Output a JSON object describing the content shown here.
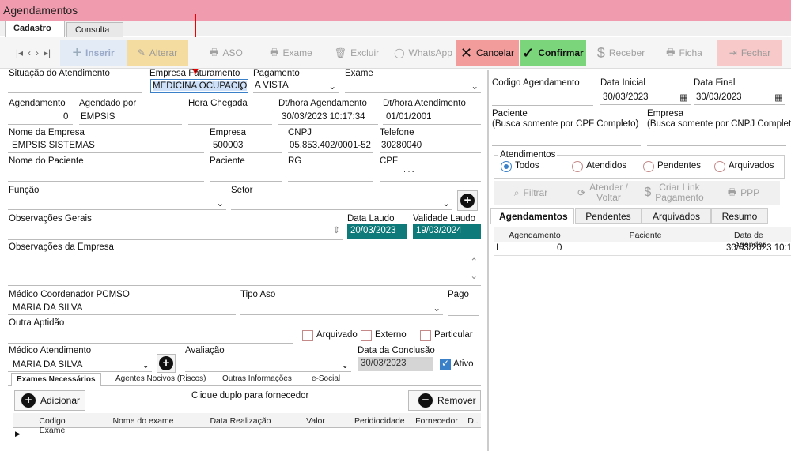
{
  "window": {
    "title": "Agendamentos"
  },
  "tabs": [
    {
      "label": "Cadastro"
    },
    {
      "label": "Consulta"
    }
  ],
  "toolbar": {
    "inserir": "Inserir",
    "alterar": "Alterar",
    "aso": "ASO",
    "exame": "Exame",
    "excluir": "Excluir",
    "whatsapp": "WhatsApp",
    "cancelar": "Cancelar",
    "confirmar": "Confirmar",
    "receber": "Receber",
    "ficha": "Ficha",
    "fechar": "Fechar"
  },
  "form": {
    "situacao_label": "Situação do Atendimento",
    "empresa_fat_label": "Empresa Faturamento",
    "empresa_fat_value": "MEDICINA OCUPACIO",
    "pagamento_label": "Pagamento",
    "pagamento_value": "A VISTA",
    "exame_label": "Exame",
    "agendamento_label": "Agendamento",
    "agendamento_value": "0",
    "agendado_por_label": "Agendado por",
    "agendado_por_value": "EMPSIS",
    "hora_chegada_label": "Hora Chegada",
    "dt_agendamento_label": "Dt/hora Agendamento",
    "dt_agendamento_value": "30/03/2023 10:17:34",
    "dt_atendimento_label": "Dt/hora Atendimento",
    "dt_atendimento_value": "01/01/2001",
    "nome_empresa_label": "Nome da Empresa",
    "nome_empresa_value": "EMPSIS SISTEMAS",
    "empresa_label": "Empresa",
    "empresa_value": "500003",
    "cnpj_label": "CNPJ",
    "cnpj_value": "05.853.402/0001-52",
    "telefone_label": "Telefone",
    "telefone_value": "30280040",
    "nome_paciente_label": "Nome do Paciente",
    "paciente_label": "Paciente",
    "rg_label": "RG",
    "cpf_label": "CPF",
    "cpf_value": "·   ·   -",
    "funcao_label": "Função",
    "setor_label": "Setor",
    "obs_gerais_label": "Observações Gerais",
    "data_laudo_label": "Data Laudo",
    "data_laudo_value": "20/03/2023",
    "validade_laudo_label": "Validade Laudo",
    "validade_laudo_value": "19/03/2024",
    "obs_empresa_label": "Observações da Empresa",
    "medico_coord_label": "Médico Coordenador PCMSO",
    "medico_coord_value": "MARIA DA SILVA",
    "tipo_aso_label": "Tipo Aso",
    "pago_label": "Pago",
    "outra_aptidao_label": "Outra Aptidão",
    "arquivado_label": "Arquivado",
    "externo_label": "Externo",
    "particular_label": "Particular",
    "medico_atend_label": "Médico Atendimento",
    "medico_atend_value": "MARIA DA SILVA",
    "avaliacao_label": "Avaliação",
    "data_conclusao_label": "Data da Conclusão",
    "data_conclusao_value": "30/03/2023",
    "ativo_label": "Ativo"
  },
  "subtabs": [
    {
      "label": "Exames Necessários"
    },
    {
      "label": "Agentes Nocivos (Riscos)"
    },
    {
      "label": "Outras Informações"
    },
    {
      "label": "e-Social"
    }
  ],
  "exames": {
    "adicionar": "Adicionar",
    "hint": "Clique duplo para fornecedor",
    "remover": "Remover",
    "columns": [
      "Codigo Exame",
      "Nome do exame",
      "Data Realização",
      "Valor",
      "Peridiocidade",
      "Fornecedor",
      "D.."
    ]
  },
  "right": {
    "codigo_label": "Codigo Agendamento",
    "data_inicial_label": "Data Inicial",
    "data_inicial_value": "30/03/2023",
    "data_final_label": "Data Final",
    "data_final_value": "30/03/2023",
    "paciente_label": "Paciente",
    "paciente_hint": "(Busca somente por CPF Completo)",
    "empresa_label": "Empresa",
    "empresa_hint": "(Busca somente por CNPJ Completo)",
    "atendimentos_label": "Atendimentos",
    "radios": [
      "Todos",
      "Atendidos",
      "Pendentes",
      "Arquivados"
    ],
    "filtrar": "Filtrar",
    "atender_voltar_1": "Atender /",
    "atender_voltar_2": "Voltar",
    "criar_link_1": "Criar Link",
    "criar_link_2": "Pagamento",
    "ppp": "PPP",
    "tabs": [
      "Agendamentos",
      "Pendentes",
      "Arquivados",
      "Resumo"
    ],
    "grid_columns": [
      "Agendamento",
      "Paciente",
      "Data de Agendar"
    ],
    "grid_row": {
      "marker": "I",
      "agendamento": "0",
      "paciente": "",
      "data": "30/03/2023 10:1"
    }
  }
}
